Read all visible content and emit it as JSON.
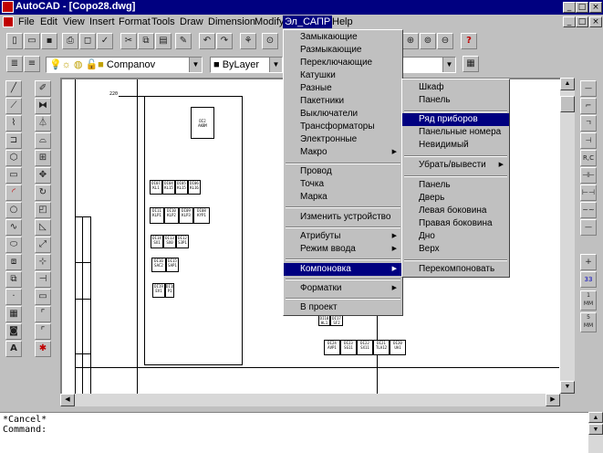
{
  "window": {
    "title": "AutoCAD - [Copo28.dwg]",
    "min": "_",
    "max": "□",
    "close": "×"
  },
  "menubar": [
    {
      "label": "File"
    },
    {
      "label": "Edit"
    },
    {
      "label": "View"
    },
    {
      "label": "Insert"
    },
    {
      "label": "Format"
    },
    {
      "label": "Tools"
    },
    {
      "label": "Draw"
    },
    {
      "label": "Dimension"
    },
    {
      "label": "Modify"
    },
    {
      "label": "Эл_САПР"
    },
    {
      "label": "Help"
    }
  ],
  "properties": {
    "layer": "Companov",
    "color": "ByLayer"
  },
  "main_menu": {
    "items": [
      "Замыкающие",
      "Размыкающие",
      "Переключающие",
      "Катушки",
      "Разные",
      "Пакетники",
      "Выключатели",
      "Трансформаторы",
      "Электронные",
      "Макро",
      "Провод",
      "Точка",
      "Марка",
      "Изменить устройство",
      "Атрибуты",
      "Режим ввода",
      "Компоновка",
      "Форматки",
      "В проект"
    ]
  },
  "sub_menu": {
    "items": [
      "Шкаф",
      "Панель",
      "Ряд приборов",
      "Панельные номера",
      "Невидимый",
      "Убрать/вывести",
      "Панель",
      "Дверь",
      "Левая боковина",
      "Правая боковина",
      "Дно",
      "Верх",
      "Перекомпоновать"
    ]
  },
  "drawing": {
    "dim_label": "220",
    "block1": "DI2\nAKBM",
    "row1": [
      "DI07\nKL1",
      "DI04\nKL15",
      "DI05\nKL15",
      "DI06\nKL16"
    ],
    "row2": [
      "DI11\nKLP1",
      "DI10\nKLP2",
      "DI09\nKLP3",
      "DI08\nKYP1"
    ],
    "row3": [
      "DI14\nSX1",
      "DI13\nSX0",
      "DI12\nS3P1"
    ],
    "row4": [
      "DI16\nSAC2",
      "DI15\nSAP1"
    ],
    "row5": [
      "DI19\nEV1",
      "DI18\nP1"
    ],
    "lower_row": [
      "DI24\nAVP1",
      "DI23\nSG11",
      "DI22\nSX11",
      "DI21\nTLA12",
      "DI20\nUA1"
    ],
    "mid_small": [
      "DI18\nHL1",
      "DI17\nSF2"
    ]
  },
  "command": {
    "line1": "*Cancel*",
    "line2": "Command:"
  },
  "right_tools": [
    "—",
    "⌐",
    "ㄱ",
    "⊣",
    "R,C",
    "⊣⊢",
    "⊢⊣",
    "~~",
    "—",
    "+",
    "33",
    "1 MM",
    "5 MM"
  ]
}
